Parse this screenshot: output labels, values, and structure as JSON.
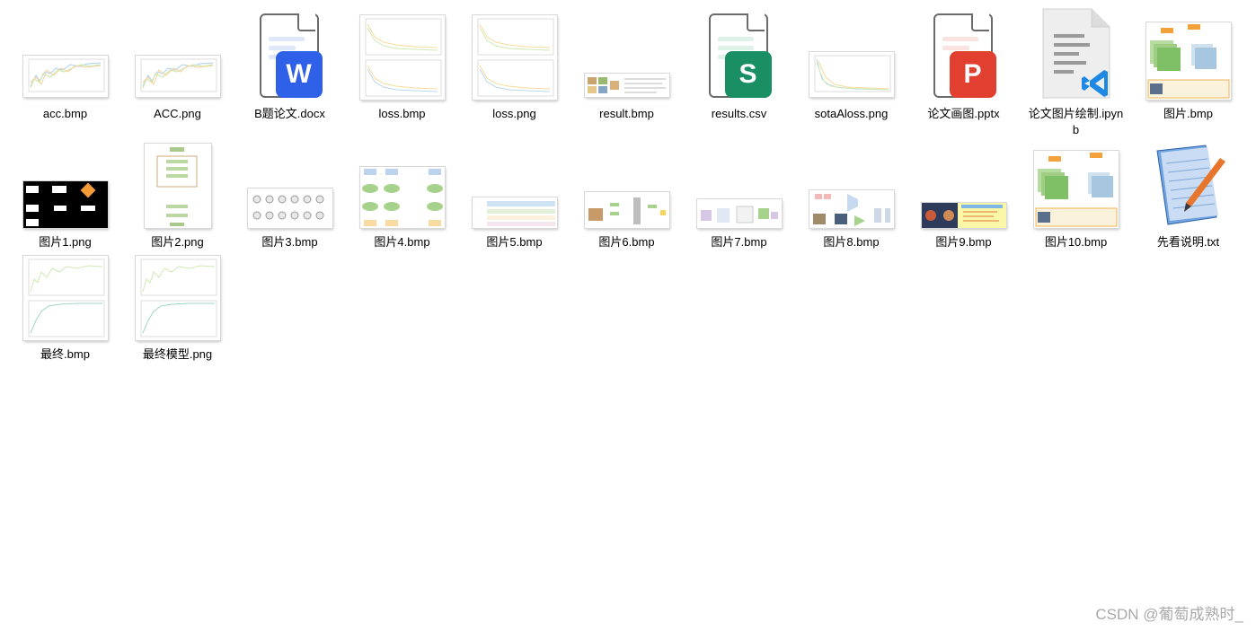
{
  "files": [
    {
      "name": "acc.bmp",
      "kind": "line-chart"
    },
    {
      "name": "ACC.png",
      "kind": "line-chart"
    },
    {
      "name": "B题论文.docx",
      "kind": "docx-icon",
      "badge_letter": "W",
      "badge_color": "#2f61e8"
    },
    {
      "name": "loss.bmp",
      "kind": "loss-chart"
    },
    {
      "name": "loss.png",
      "kind": "loss-chart"
    },
    {
      "name": "result.bmp",
      "kind": "figure-image"
    },
    {
      "name": "results.csv",
      "kind": "csv-icon",
      "badge_letter": "S",
      "badge_color": "#1a8f63"
    },
    {
      "name": "sotaAloss.png",
      "kind": "loss-chart"
    },
    {
      "name": "论文画图.pptx",
      "kind": "pptx-icon",
      "badge_letter": "P",
      "badge_color": "#e13f2f"
    },
    {
      "name": "论文图片绘制.ipynb",
      "kind": "ipynb-icon"
    },
    {
      "name": "图片.bmp",
      "kind": "diagram-image"
    },
    {
      "name": "图片1.png",
      "kind": "flowchart-image"
    },
    {
      "name": "图片2.png",
      "kind": "flowchart-image"
    },
    {
      "name": "图片3.bmp",
      "kind": "network-image"
    },
    {
      "name": "图片4.bmp",
      "kind": "network-image"
    },
    {
      "name": "图片5.bmp",
      "kind": "table-image"
    },
    {
      "name": "图片6.bmp",
      "kind": "diagram-image"
    },
    {
      "name": "图片7.bmp",
      "kind": "diagram-image"
    },
    {
      "name": "图片8.bmp",
      "kind": "diagram-image"
    },
    {
      "name": "图片9.bmp",
      "kind": "photo-image"
    },
    {
      "name": "图片10.bmp",
      "kind": "diagram-image"
    },
    {
      "name": "先看说明.txt",
      "kind": "txt-icon"
    },
    {
      "name": "最终.bmp",
      "kind": "line-chart"
    },
    {
      "name": "最终模型.png",
      "kind": "line-chart"
    }
  ],
  "watermark": "CSDN @葡萄成熟时_"
}
